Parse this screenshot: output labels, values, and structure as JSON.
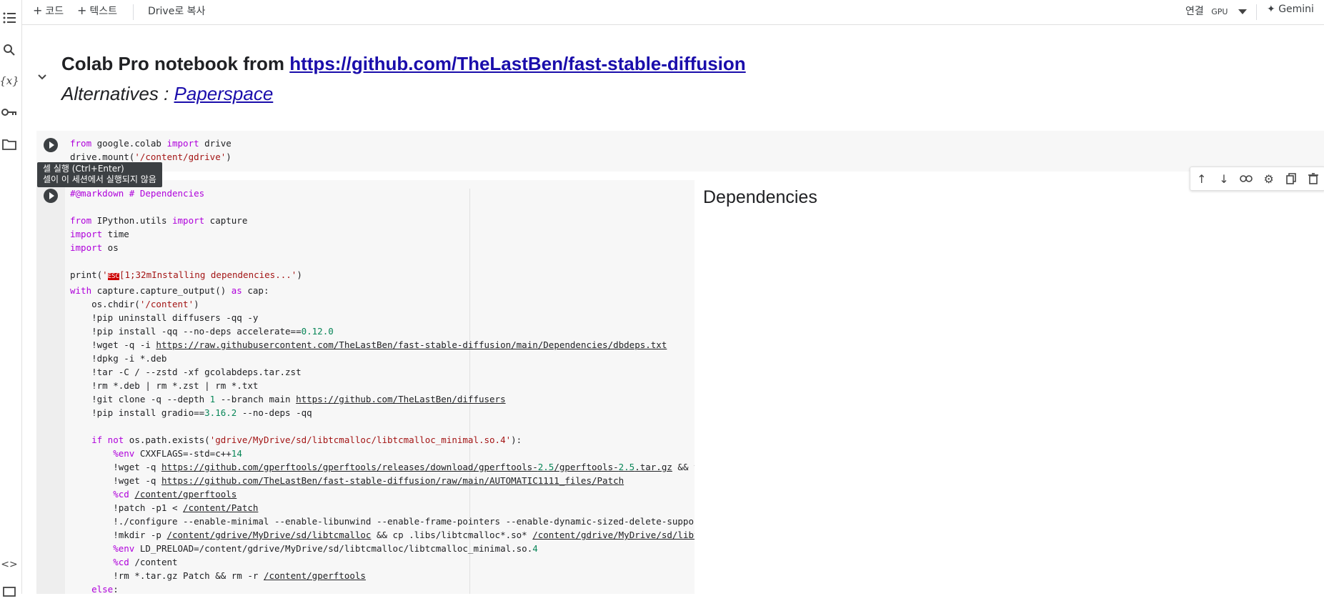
{
  "toolbar": {
    "add_code": "코드",
    "add_text": "텍스트",
    "copy_to_drive": "Drive로 복사",
    "connect": "연결",
    "runtime": "GPU",
    "gemini": "Gemini"
  },
  "sidebar": {
    "icons": [
      "table-of-contents-icon",
      "search-icon",
      "variables-icon",
      "key-icon",
      "folder-icon",
      "code-snippets-icon",
      "terminal-icon"
    ]
  },
  "heading": {
    "title_prefix": "Colab Pro notebook from ",
    "title_link": "https://github.com/TheLastBen/fast-stable-diffusion",
    "alt_prefix": "Alternatives : ",
    "alt_link": "Paperspace"
  },
  "tooltip": {
    "line1": "셀 실행 (Ctrl+Enter)",
    "line2": "셀이 이 세션에서 실행되지 않음"
  },
  "cell2_output": {
    "heading": "Dependencies"
  },
  "colors": {
    "keyword": "#af00db",
    "string": "#a31515",
    "number": "#098658",
    "link": "#1a0dab",
    "cell_bg": "#f7f7f7"
  }
}
